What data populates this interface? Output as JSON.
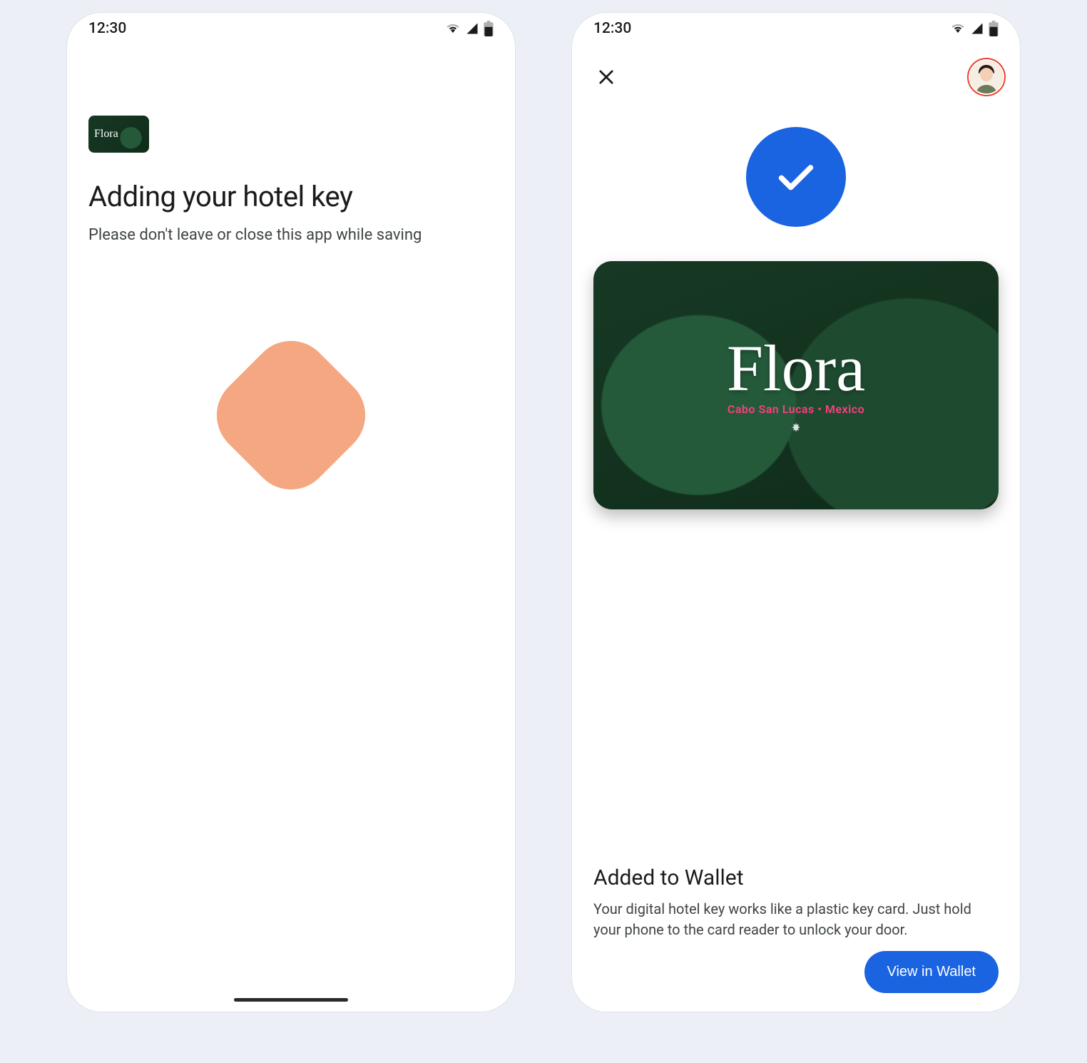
{
  "statusbar": {
    "time": "12:30"
  },
  "screen1": {
    "brand_mini": "Flora",
    "title": "Adding your hotel key",
    "subtitle": "Please don't leave or close this app while saving"
  },
  "screen2": {
    "card": {
      "brand": "Flora",
      "location": "Cabo San Lucas  •  Mexico"
    },
    "heading": "Added to Wallet",
    "description": "Your digital hotel key works like a plastic key card. Just hold your phone to the card reader to unlock your door.",
    "cta": "View in Wallet"
  }
}
